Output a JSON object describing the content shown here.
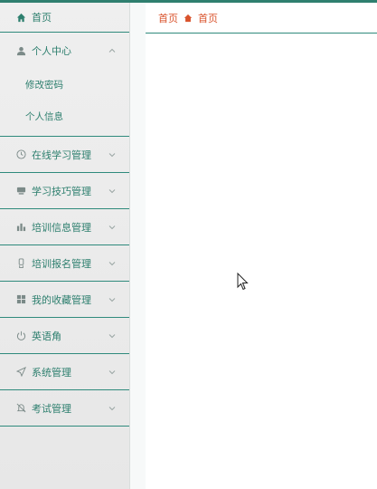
{
  "sidebar": {
    "items": [
      {
        "label": "首页",
        "icon": "home-icon",
        "expanded": false
      },
      {
        "label": "个人中心",
        "icon": "user-icon",
        "expanded": true,
        "children": [
          {
            "label": "修改密码"
          },
          {
            "label": "个人信息"
          }
        ]
      },
      {
        "label": "在线学习管理",
        "icon": "clock-icon"
      },
      {
        "label": "学习技巧管理",
        "icon": "monitor-icon"
      },
      {
        "label": "培训信息管理",
        "icon": "bar-chart-icon"
      },
      {
        "label": "培训报名管理",
        "icon": "badge-icon"
      },
      {
        "label": "我的收藏管理",
        "icon": "grid-icon"
      },
      {
        "label": "英语角",
        "icon": "power-icon"
      },
      {
        "label": "系统管理",
        "icon": "send-icon"
      },
      {
        "label": "考试管理",
        "icon": "bell-off-icon"
      }
    ]
  },
  "breadcrumb": {
    "first": "首页",
    "second": "首页"
  },
  "colors": {
    "accent": "#2d7f6e",
    "breadcrumb": "#d9532c",
    "topbar": "#2f7f6f"
  }
}
